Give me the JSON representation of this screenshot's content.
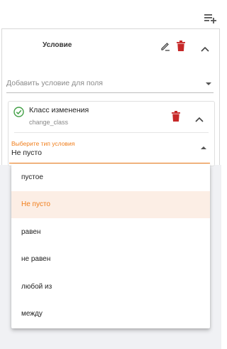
{
  "condition_panel": {
    "title": "Условие",
    "field_select_placeholder": "Добавить условие для поля"
  },
  "condition_card": {
    "title": "Класс изменения",
    "subtitle": "change_class",
    "type_label": "Выберите тип условия",
    "type_value": "Не пусто"
  },
  "dropdown": {
    "options": [
      "пустое",
      "Не пусто",
      "равен",
      "не равен",
      "любой из",
      "между"
    ],
    "selected_index": 1
  },
  "colors": {
    "accent": "#f07d1a",
    "delete": "#c62828",
    "success": "#43a047",
    "selected_bg": "#fceee5"
  }
}
